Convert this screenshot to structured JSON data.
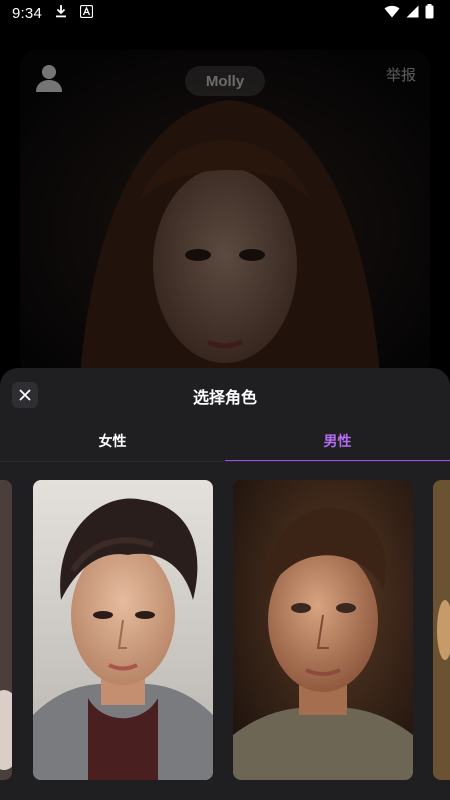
{
  "status_bar": {
    "time": "9:34",
    "left_icons": [
      "download-icon",
      "a-notification-icon"
    ],
    "right_icons": [
      "wifi-icon",
      "signal-icon",
      "battery-icon"
    ]
  },
  "background_card": {
    "name": "Molly",
    "report_label": "举报",
    "avatar_icon": "person-icon"
  },
  "sheet": {
    "title": "选择角色",
    "close_icon": "close-icon",
    "tabs": [
      {
        "label": "女性",
        "active": false
      },
      {
        "label": "男性",
        "active": true
      }
    ]
  },
  "characters": [
    {
      "label": "partial-left-character"
    },
    {
      "label": "asian-young-man-portrait"
    },
    {
      "label": "young-man-portrait"
    },
    {
      "label": "partial-right-character"
    }
  ],
  "colors": {
    "accent": "#9b4ee8",
    "sheet_bg": "#1f1f22",
    "page_bg": "#000000"
  }
}
